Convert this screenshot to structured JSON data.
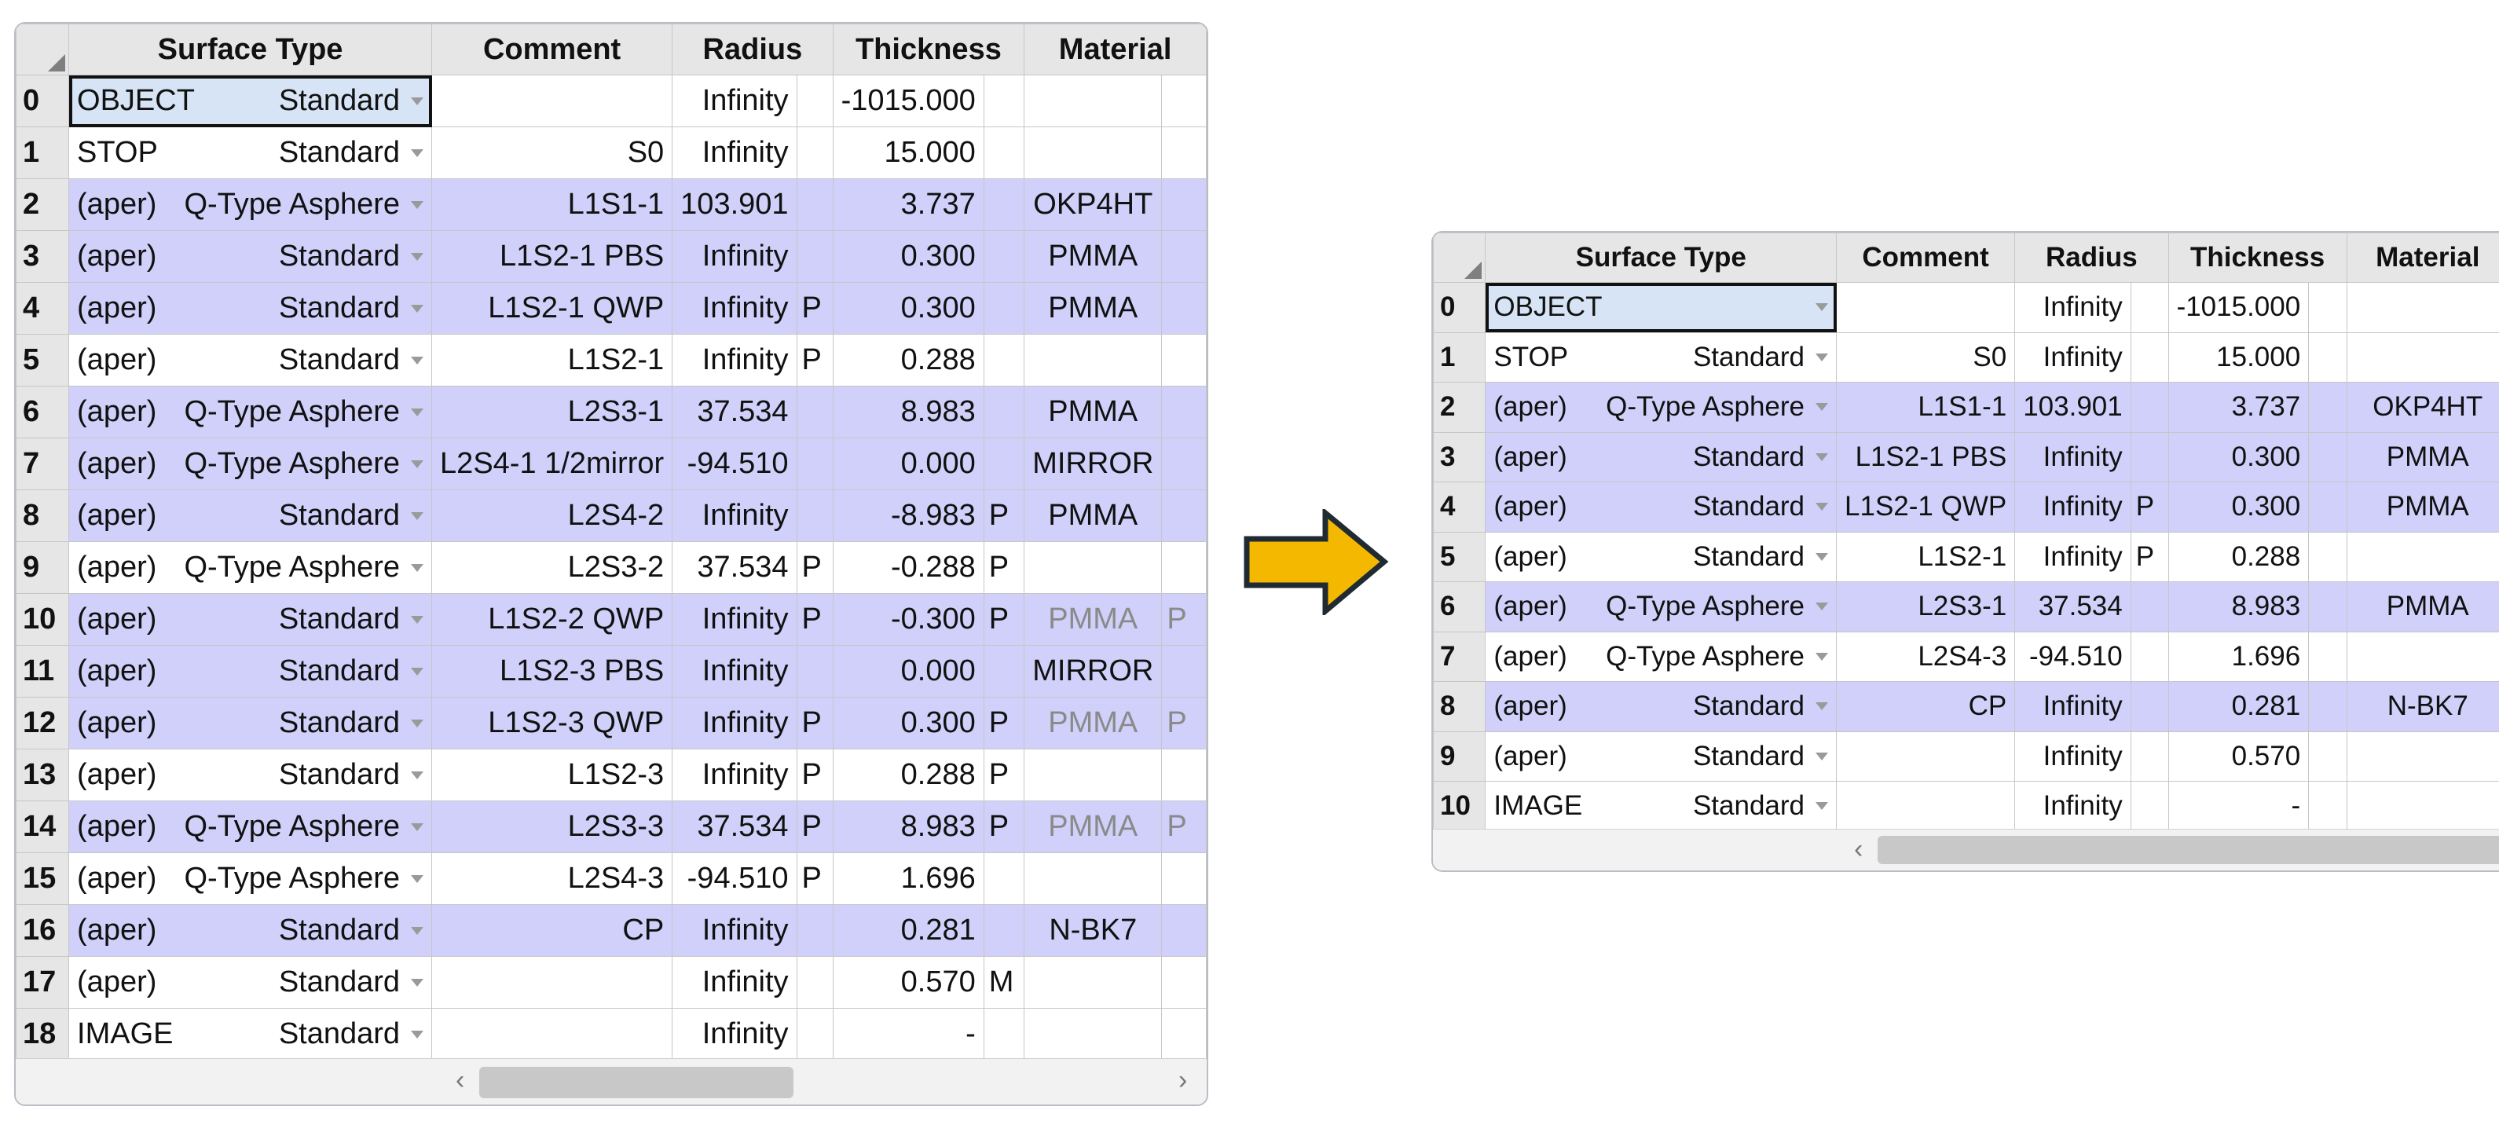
{
  "colors": {
    "row_highlight": "#d0d0fa",
    "header_bg": "#e6e6e6",
    "selected_cell_bg": "#d6e4f6",
    "arrow_fill": "#f5b800",
    "arrow_stroke": "#1f2a33"
  },
  "icons": {
    "dropdown": "chevron-down-icon",
    "transition": "right-arrow-icon",
    "scroll_left": "chevron-left-icon",
    "scroll_right": "chevron-right-icon"
  },
  "left_editor": {
    "headers": {
      "surface_type": "Surface Type",
      "comment": "Comment",
      "radius": "Radius",
      "thickness": "Thickness",
      "material": "Material"
    },
    "rows": [
      {
        "num": "0",
        "aper": "OBJECT",
        "type": "Standard",
        "comment": "",
        "radius": "Infinity",
        "radius_flag": "",
        "thickness": "-1015.000",
        "thick_flag": "",
        "material": "",
        "mat_flag": ""
      },
      {
        "num": "1",
        "aper": "STOP",
        "type": "Standard",
        "comment": "S0",
        "radius": "Infinity",
        "radius_flag": "",
        "thickness": "15.000",
        "thick_flag": "",
        "material": "",
        "mat_flag": ""
      },
      {
        "num": "2",
        "aper": "(aper)",
        "type": "Q-Type Asphere",
        "comment": "L1S1-1",
        "radius": "103.901",
        "radius_flag": "",
        "thickness": "3.737",
        "thick_flag": "",
        "material": "OKP4HT",
        "mat_flag": ""
      },
      {
        "num": "3",
        "aper": "(aper)",
        "type": "Standard",
        "comment": "L1S2-1 PBS",
        "radius": "Infinity",
        "radius_flag": "",
        "thickness": "0.300",
        "thick_flag": "",
        "material": "PMMA",
        "mat_flag": ""
      },
      {
        "num": "4",
        "aper": "(aper)",
        "type": "Standard",
        "comment": "L1S2-1 QWP",
        "radius": "Infinity",
        "radius_flag": "P",
        "thickness": "0.300",
        "thick_flag": "",
        "material": "PMMA",
        "mat_flag": ""
      },
      {
        "num": "5",
        "aper": "(aper)",
        "type": "Standard",
        "comment": "L1S2-1",
        "radius": "Infinity",
        "radius_flag": "P",
        "thickness": "0.288",
        "thick_flag": "",
        "material": "",
        "mat_flag": ""
      },
      {
        "num": "6",
        "aper": "(aper)",
        "type": "Q-Type Asphere",
        "comment": "L2S3-1",
        "radius": "37.534",
        "radius_flag": "",
        "thickness": "8.983",
        "thick_flag": "",
        "material": "PMMA",
        "mat_flag": ""
      },
      {
        "num": "7",
        "aper": "(aper)",
        "type": "Q-Type Asphere",
        "comment": "L2S4-1 1/2mirror",
        "radius": "-94.510",
        "radius_flag": "",
        "thickness": "0.000",
        "thick_flag": "",
        "material": "MIRROR",
        "mat_flag": ""
      },
      {
        "num": "8",
        "aper": "(aper)",
        "type": "Standard",
        "comment": "L2S4-2",
        "radius": "Infinity",
        "radius_flag": "",
        "thickness": "-8.983",
        "thick_flag": "P",
        "material": "PMMA",
        "mat_flag": ""
      },
      {
        "num": "9",
        "aper": "(aper)",
        "type": "Q-Type Asphere",
        "comment": "L2S3-2",
        "radius": "37.534",
        "radius_flag": "P",
        "thickness": "-0.288",
        "thick_flag": "P",
        "material": "",
        "mat_flag": ""
      },
      {
        "num": "10",
        "aper": "(aper)",
        "type": "Standard",
        "comment": "L1S2-2 QWP",
        "radius": "Infinity",
        "radius_flag": "P",
        "thickness": "-0.300",
        "thick_flag": "P",
        "material": "PMMA",
        "mat_flag": "P"
      },
      {
        "num": "11",
        "aper": "(aper)",
        "type": "Standard",
        "comment": "L1S2-3 PBS",
        "radius": "Infinity",
        "radius_flag": "",
        "thickness": "0.000",
        "thick_flag": "",
        "material": "MIRROR",
        "mat_flag": ""
      },
      {
        "num": "12",
        "aper": "(aper)",
        "type": "Standard",
        "comment": "L1S2-3 QWP",
        "radius": "Infinity",
        "radius_flag": "P",
        "thickness": "0.300",
        "thick_flag": "P",
        "material": "PMMA",
        "mat_flag": "P"
      },
      {
        "num": "13",
        "aper": "(aper)",
        "type": "Standard",
        "comment": "L1S2-3",
        "radius": "Infinity",
        "radius_flag": "P",
        "thickness": "0.288",
        "thick_flag": "P",
        "material": "",
        "mat_flag": ""
      },
      {
        "num": "14",
        "aper": "(aper)",
        "type": "Q-Type Asphere",
        "comment": "L2S3-3",
        "radius": "37.534",
        "radius_flag": "P",
        "thickness": "8.983",
        "thick_flag": "P",
        "material": "PMMA",
        "mat_flag": "P"
      },
      {
        "num": "15",
        "aper": "(aper)",
        "type": "Q-Type Asphere",
        "comment": "L2S4-3",
        "radius": "-94.510",
        "radius_flag": "P",
        "thickness": "1.696",
        "thick_flag": "",
        "material": "",
        "mat_flag": ""
      },
      {
        "num": "16",
        "aper": "(aper)",
        "type": "Standard",
        "comment": "CP",
        "radius": "Infinity",
        "radius_flag": "",
        "thickness": "0.281",
        "thick_flag": "",
        "material": "N-BK7",
        "mat_flag": ""
      },
      {
        "num": "17",
        "aper": "(aper)",
        "type": "Standard",
        "comment": "",
        "radius": "Infinity",
        "radius_flag": "",
        "thickness": "0.570",
        "thick_flag": "M",
        "material": "",
        "mat_flag": ""
      },
      {
        "num": "18",
        "aper": "IMAGE",
        "type": "Standard",
        "comment": "",
        "radius": "Infinity",
        "radius_flag": "",
        "thickness": "-",
        "thick_flag": "",
        "material": "",
        "mat_flag": ""
      }
    ]
  },
  "right_editor": {
    "headers": {
      "surface_type": "Surface Type",
      "comment": "Comment",
      "radius": "Radius",
      "thickness": "Thickness",
      "material": "Material"
    },
    "rows": [
      {
        "num": "0",
        "aper": "OBJECT",
        "type": "",
        "comment": "",
        "radius": "Infinity",
        "radius_flag": "",
        "thickness": "-1015.000",
        "thick_flag": "",
        "material": ""
      },
      {
        "num": "1",
        "aper": "STOP",
        "type": "Standard",
        "comment": "S0",
        "radius": "Infinity",
        "radius_flag": "",
        "thickness": "15.000",
        "thick_flag": "",
        "material": ""
      },
      {
        "num": "2",
        "aper": "(aper)",
        "type": "Q-Type Asphere",
        "comment": "L1S1-1",
        "radius": "103.901",
        "radius_flag": "",
        "thickness": "3.737",
        "thick_flag": "",
        "material": "OKP4HT"
      },
      {
        "num": "3",
        "aper": "(aper)",
        "type": "Standard",
        "comment": "L1S2-1 PBS",
        "radius": "Infinity",
        "radius_flag": "",
        "thickness": "0.300",
        "thick_flag": "",
        "material": "PMMA"
      },
      {
        "num": "4",
        "aper": "(aper)",
        "type": "Standard",
        "comment": "L1S2-1 QWP",
        "radius": "Infinity",
        "radius_flag": "P",
        "thickness": "0.300",
        "thick_flag": "",
        "material": "PMMA"
      },
      {
        "num": "5",
        "aper": "(aper)",
        "type": "Standard",
        "comment": "L1S2-1",
        "radius": "Infinity",
        "radius_flag": "P",
        "thickness": "0.288",
        "thick_flag": "",
        "material": ""
      },
      {
        "num": "6",
        "aper": "(aper)",
        "type": "Q-Type Asphere",
        "comment": "L2S3-1",
        "radius": "37.534",
        "radius_flag": "",
        "thickness": "8.983",
        "thick_flag": "",
        "material": "PMMA"
      },
      {
        "num": "7",
        "aper": "(aper)",
        "type": "Q-Type Asphere",
        "comment": "L2S4-3",
        "radius": "-94.510",
        "radius_flag": "",
        "thickness": "1.696",
        "thick_flag": "",
        "material": ""
      },
      {
        "num": "8",
        "aper": "(aper)",
        "type": "Standard",
        "comment": "CP",
        "radius": "Infinity",
        "radius_flag": "",
        "thickness": "0.281",
        "thick_flag": "",
        "material": "N-BK7"
      },
      {
        "num": "9",
        "aper": "(aper)",
        "type": "Standard",
        "comment": "",
        "radius": "Infinity",
        "radius_flag": "",
        "thickness": "0.570",
        "thick_flag": "",
        "material": ""
      },
      {
        "num": "10",
        "aper": "IMAGE",
        "type": "Standard",
        "comment": "",
        "radius": "Infinity",
        "radius_flag": "",
        "thickness": "-",
        "thick_flag": "",
        "material": ""
      }
    ]
  }
}
